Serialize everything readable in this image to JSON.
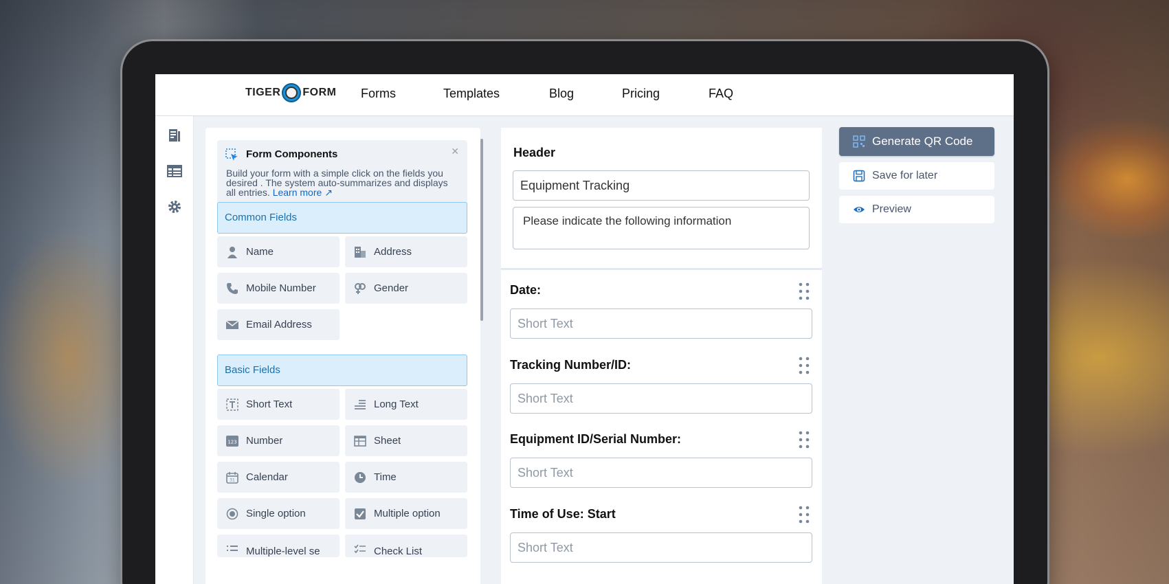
{
  "nav": {
    "logo_left": "TIGER",
    "logo_right": "FORM",
    "links": [
      "Forms",
      "Templates",
      "Blog",
      "Pricing",
      "FAQ"
    ]
  },
  "rail": {
    "icons": [
      "document-icon",
      "table-icon",
      "gear-icon"
    ]
  },
  "components": {
    "title": "Form Components",
    "description": "Build your form with a simple click on the fields you desired . The system auto-summarizes and displays all entries.",
    "learn_more": "Learn more",
    "common_heading": "Common Fields",
    "common": [
      "Name",
      "Address",
      "Mobile Number",
      "Gender",
      "Email Address"
    ],
    "basic_heading": "Basic Fields",
    "basic": [
      "Short Text",
      "Long Text",
      "Number",
      "Sheet",
      "Calendar",
      "Time",
      "Single option",
      "Multiple option",
      "Multiple-level se",
      "Check List"
    ]
  },
  "form": {
    "header_label": "Header",
    "title_value": "Equipment Tracking",
    "description_value": "Please indicate the following information",
    "questions": [
      {
        "label": "Date:",
        "placeholder": "Short Text"
      },
      {
        "label": "Tracking Number/ID:",
        "placeholder": "Short Text"
      },
      {
        "label": "Equipment ID/Serial Number:",
        "placeholder": "Short Text"
      },
      {
        "label": "Time of Use: Start",
        "placeholder": "Short Text"
      }
    ]
  },
  "actions": {
    "generate": "Generate QR Code",
    "save": "Save for later",
    "preview": "Preview"
  },
  "colors": {
    "primary_button": "#5e6f88",
    "section_bg": "#dbeefc",
    "link": "#1565c0"
  }
}
